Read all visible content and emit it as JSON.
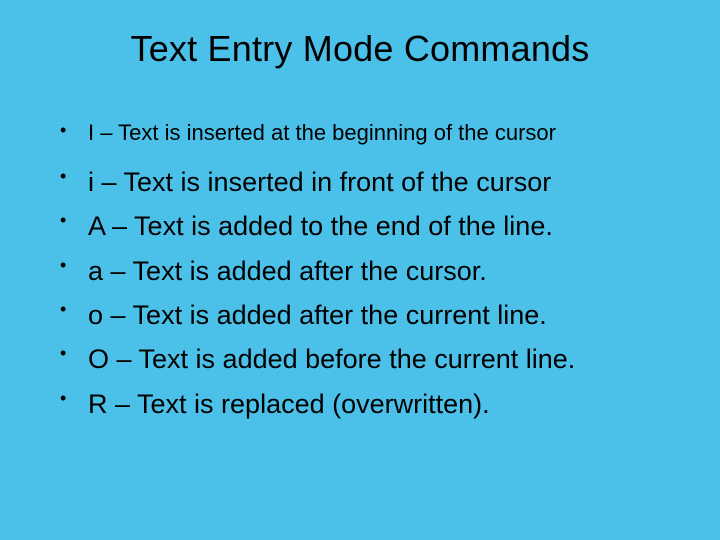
{
  "title": "Text Entry Mode Commands",
  "items": {
    "0": "I – Text is inserted at the beginning of the cursor",
    "1": "i – Text is inserted in front of the cursor",
    "2": "A – Text is added to the end of the line.",
    "3": " a – Text is added after the cursor.",
    "4": " o – Text is added after the current line.",
    "5": "O – Text is added before the current line.",
    "6": "R – Text is replaced (overwritten)."
  }
}
